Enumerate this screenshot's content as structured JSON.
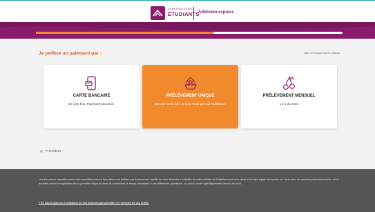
{
  "header": {
    "logo_small": "LA MUTUELLE DES",
    "logo_big": "ÉTUDIANTS",
    "title": "Adhésion express"
  },
  "progress": {
    "fraction": 0.58
  },
  "main": {
    "heading": "Je préfère un paiement par :",
    "helper": "Merci de remplir tous les champs",
    "cards": [
      {
        "title": "CARTE BANCAIRE",
        "sub": "En une fois. Paiement sécurisé.",
        "icon": "phone-card-icon",
        "selected": false
      },
      {
        "title": "PRÉLÈVEMENT UNIQUE",
        "sub": "En une seule fois, le 5 du mois qui suit l'adhésion",
        "icon": "fruit-basket-icon",
        "selected": true
      },
      {
        "title": "PRÉLÈVEMENT MENSUEL",
        "sub": "Le 5 du mois",
        "icon": "cherry-icon",
        "selected": false
      }
    ],
    "back_label": "Précédent"
  },
  "footer": {
    "text": "Les données à caractère personnel recueillies dans ce formulaire sont traitées par le personnel habilité de notre Mutuelle. La finalité de cette collecte est l'établissement d'un devis et la base légale est fondée sur l'exécution de mesures précontractuelles. Vous données seront enregistrées dès la première étape du devis et conservées le temps nécessaire à ces différentes opérations, ou pour la durée spécifiquement prévue par la loi.",
    "more": "» En savoir plus sur l'utilisation de vos données personnelles et l'exercice de vos droits."
  },
  "colors": {
    "brand": "#8b1c6b",
    "accent": "#f18a2c",
    "heading": "#e0592a",
    "footer_bg": "#555555"
  }
}
